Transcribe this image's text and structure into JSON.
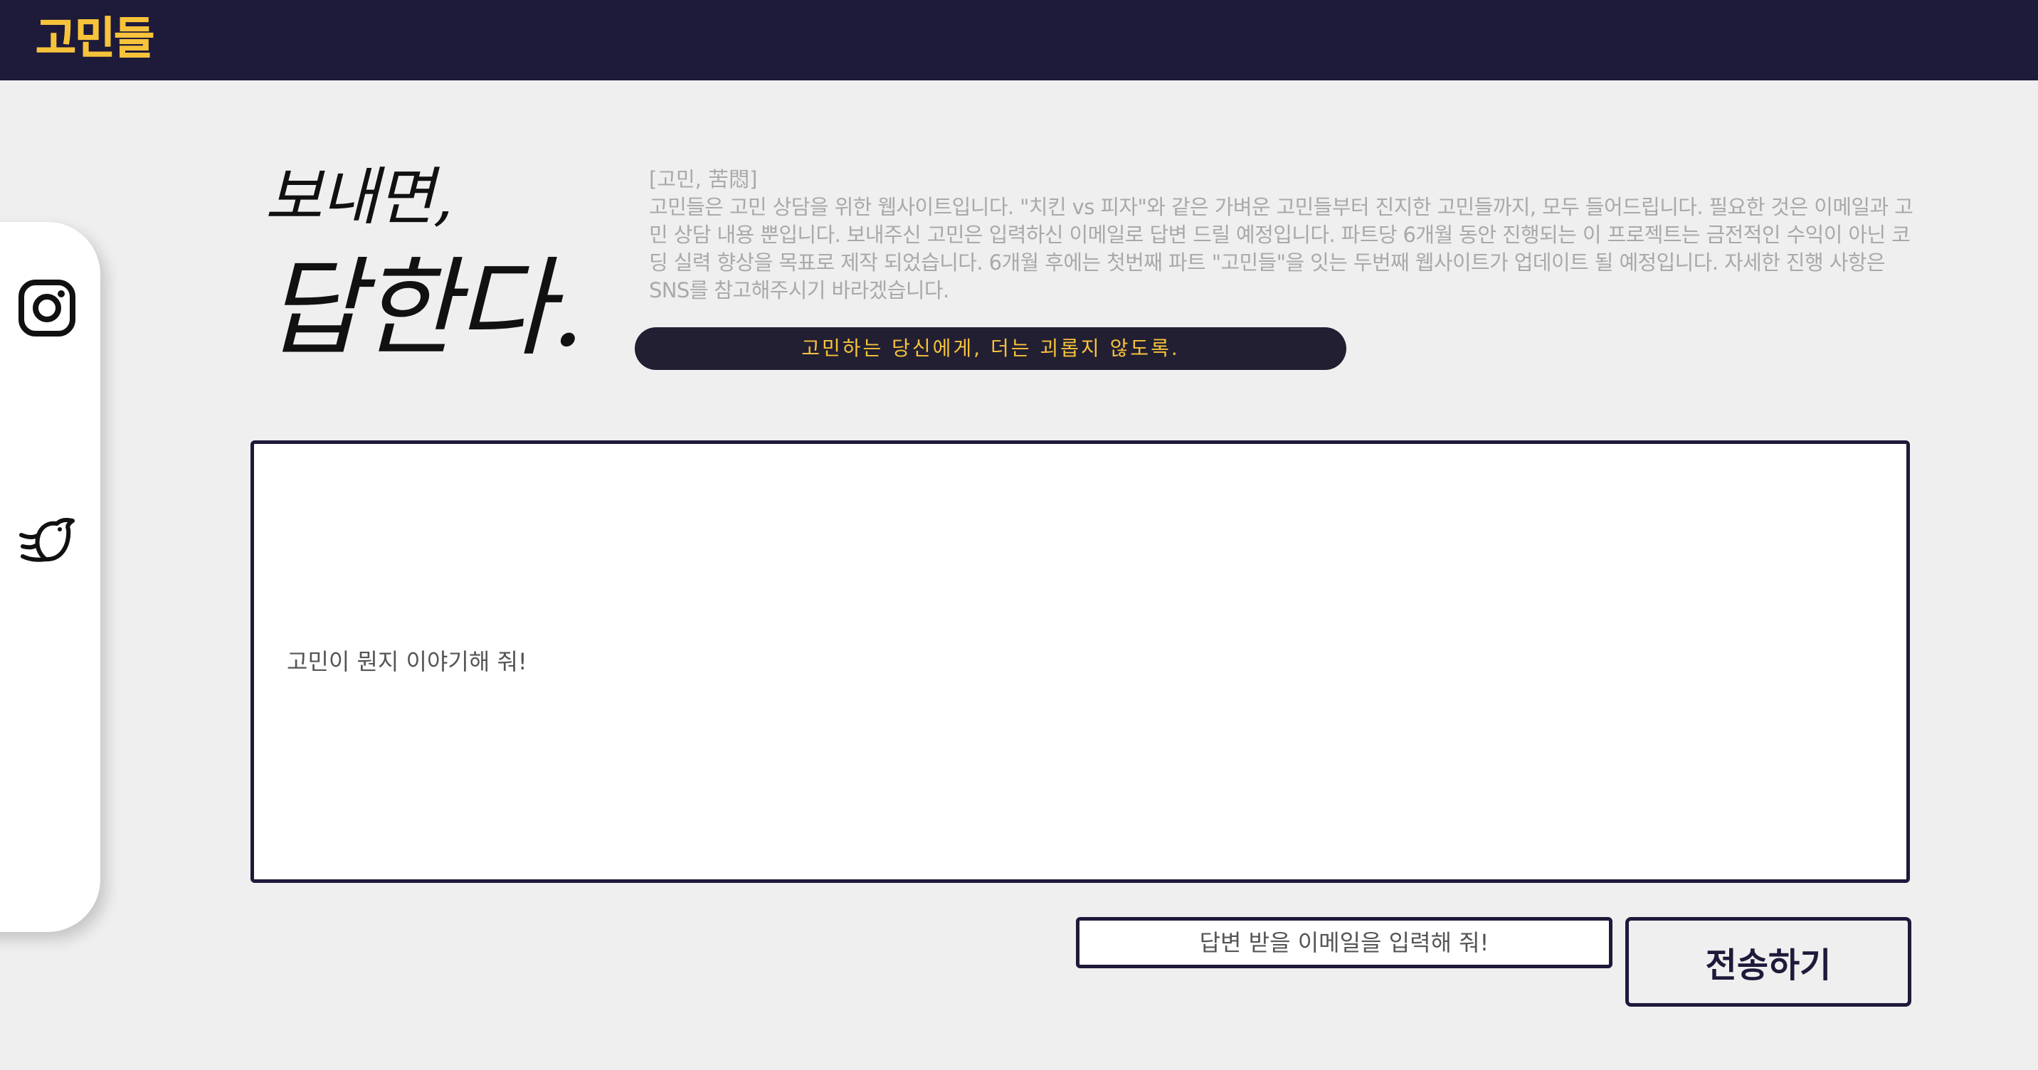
{
  "header": {
    "logo": "고민들",
    "bg_color": "#1e1a3a",
    "logo_color": "#f7c33b"
  },
  "social": {
    "instagram_icon": "instagram-icon",
    "twitter_icon": "twitter-bird-icon"
  },
  "hero": {
    "line1": "보내면,",
    "line2": "답한다."
  },
  "description": {
    "title": "[고민, 苦悶]",
    "body": "고민들은 고민 상담을 위한 웹사이트입니다. \"치킨 vs 피자\"와 같은 가벼운 고민들부터 진지한 고민들까지, 모두 들어드립니다. 필요한 것은 이메일과 고민 상담 내용 뿐입니다. 보내주신 고민은 입력하신 이메일로 답변 드릴 예정입니다. 파트당 6개월 동안 진행되는 이 프로젝트는 금전적인 수익이 아닌 코딩 실력 향상을 목표로 제작 되었습니다. 6개월 후에는 첫번째 파트 \"고민들\"을 잇는 두번째 웹사이트가 업데이트 될 예정입니다. 자세한 진행 사항은 SNS를 참고해주시기 바라겠습니다."
  },
  "slogan": "고민하는 당신에게, 더는 괴롭지 않도록.",
  "form": {
    "concern_placeholder": "고민이 뭔지 이야기해 줘!",
    "email_placeholder": "답변 받을 이메일을 입력해 줘!",
    "submit_label": "전송하기"
  },
  "colors": {
    "accent": "#f7c33b",
    "navy": "#1e1a3a",
    "background": "#efefef"
  }
}
